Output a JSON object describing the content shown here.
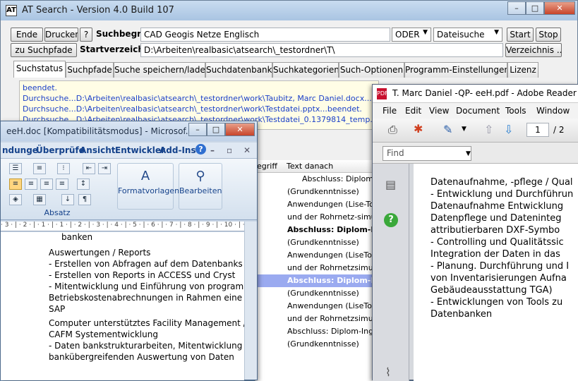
{
  "at_search": {
    "title": "AT Search - Version 4.0 Build 107",
    "caption": {
      "minimize": "–",
      "maximize": "□",
      "close": "✕"
    },
    "buttons": {
      "ende": "Ende",
      "drucken": "Drucken",
      "help": "?",
      "zu_suchpfade": "zu Suchpfade",
      "start": "Start",
      "stop": "Stop",
      "verzeichnis": "Verzeichnis ..."
    },
    "suchbegriff_label": "Suchbegriff",
    "suchbegriff_value": "CAD Geogis Netze Englisch",
    "operator": "ODER",
    "searchtype": "Dateisuche",
    "startverzeichnis_label": "Startverzeichnis",
    "startverzeichnis_value": "D:\\Arbeiten\\realbasic\\atsearch\\_testordner\\T\\",
    "tabs": [
      "Suchstatus",
      "Suchpfade",
      "Suche speichern/laden",
      "Suchdatenbank",
      "Suchkategorien",
      "Such-Optionen",
      "Programm-Einstellungen",
      "Lizenz"
    ],
    "status_lines": [
      "beendet.",
      "Durchsuche...D:\\Arbeiten\\realbasic\\atsearch\\_testordner\\work\\Taubitz, Marc Daniel.docx...be",
      "Durchsuche...D:\\Arbeiten\\realbasic\\atsearch\\_testordner\\work\\Testdatei.pptx...beendet.",
      "Durchsuche...D:\\Arbeiten\\realbasic\\atsearch\\_testordner\\work\\Testdatei_0.1379814_temp.ppt..."
    ],
    "table": {
      "col_partial": "egriff",
      "col_text_danach": "Text danach",
      "rows": [
        "Abschluss: Diplom-",
        "(Grundkenntnisse)",
        "Anwendungen (Lise-To",
        "und der Rohrnetz-simul",
        "Abschluss: Diplom-Ing",
        "(Grundkenntnisse)",
        "Anwendungen (LiseTo",
        "und der Rohrnetzsimul",
        "Abschluss: Diplom-Ing",
        "(Grundkenntnisse)",
        "Anwendungen (LiseToc",
        "und der Rohrnetzsimul",
        "Abschluss: Diplom-Ing",
        "(Grundkenntnisse)"
      ]
    }
  },
  "word": {
    "title": "eeH.doc [Kompatibilitätsmodus] - Microsof...",
    "caption": {
      "minimize": "–",
      "maximize": "□",
      "close": "✕"
    },
    "ribbon_tabs": [
      "ndunge",
      "Überprüfe",
      "Ansicht",
      "Entwickler",
      "Add-Ins"
    ],
    "ribbon_help": "?",
    "formatvorlagen": "Formatvorlagen",
    "bearbeiten": "Bearbeiten",
    "absatz": "Absatz",
    "ruler": "· 3 · | · 2 · | · 1 · | · 1 · | · 2 · | · 3 · | · 4 · | · 5 · | · 6 · | · 7 · | · 8 · | · 9 · | · 10 · | · 11 · | · 12 ·",
    "doc_lines": [
      "banken",
      "Auswertungen / Reports",
      "-    Erstellen von  Abfragen  auf dem Datenbanks",
      "-    Erstellen von  Reports in ACCESS und Cryst",
      "-    Mitentwicklung und Einführung von programm",
      "      Betriebskostenabrechnungen in Rahmen eine",
      "      SAP",
      "Computer unterstütztes Facility Management / Dat",
      "CAFM Systementwicklung",
      "-    Daten bankstrukturarbeiten,  Mitentwicklung",
      "      bankübergreifenden  Auswertung von Daten"
    ]
  },
  "reader": {
    "title": "T. Marc Daniel  -QP- eeH.pdf - Adobe Reader",
    "menu": [
      "File",
      "Edit",
      "View",
      "Document",
      "Tools",
      "Window"
    ],
    "page_current": "1",
    "page_total": "/ 2",
    "find_placeholder": "Find",
    "page_lines": [
      "Datenaufnahme, -pflege / Qual",
      "-    Entwicklung und Durchführun",
      "      Datenaufnahme Entwicklung",
      "      Datenpflege und Dateninteg",
      "      attributierbaren DXF-Symbo",
      "-    Controlling und Qualitätssic",
      "      Integration der Daten in das",
      "-    Planung. Durchführung und I",
      "      von Inventarisierungen Aufna",
      "      Gebäudeausstattung TGA)",
      "-    Entwicklungen von Tools zu",
      "      Datenbanken"
    ]
  }
}
